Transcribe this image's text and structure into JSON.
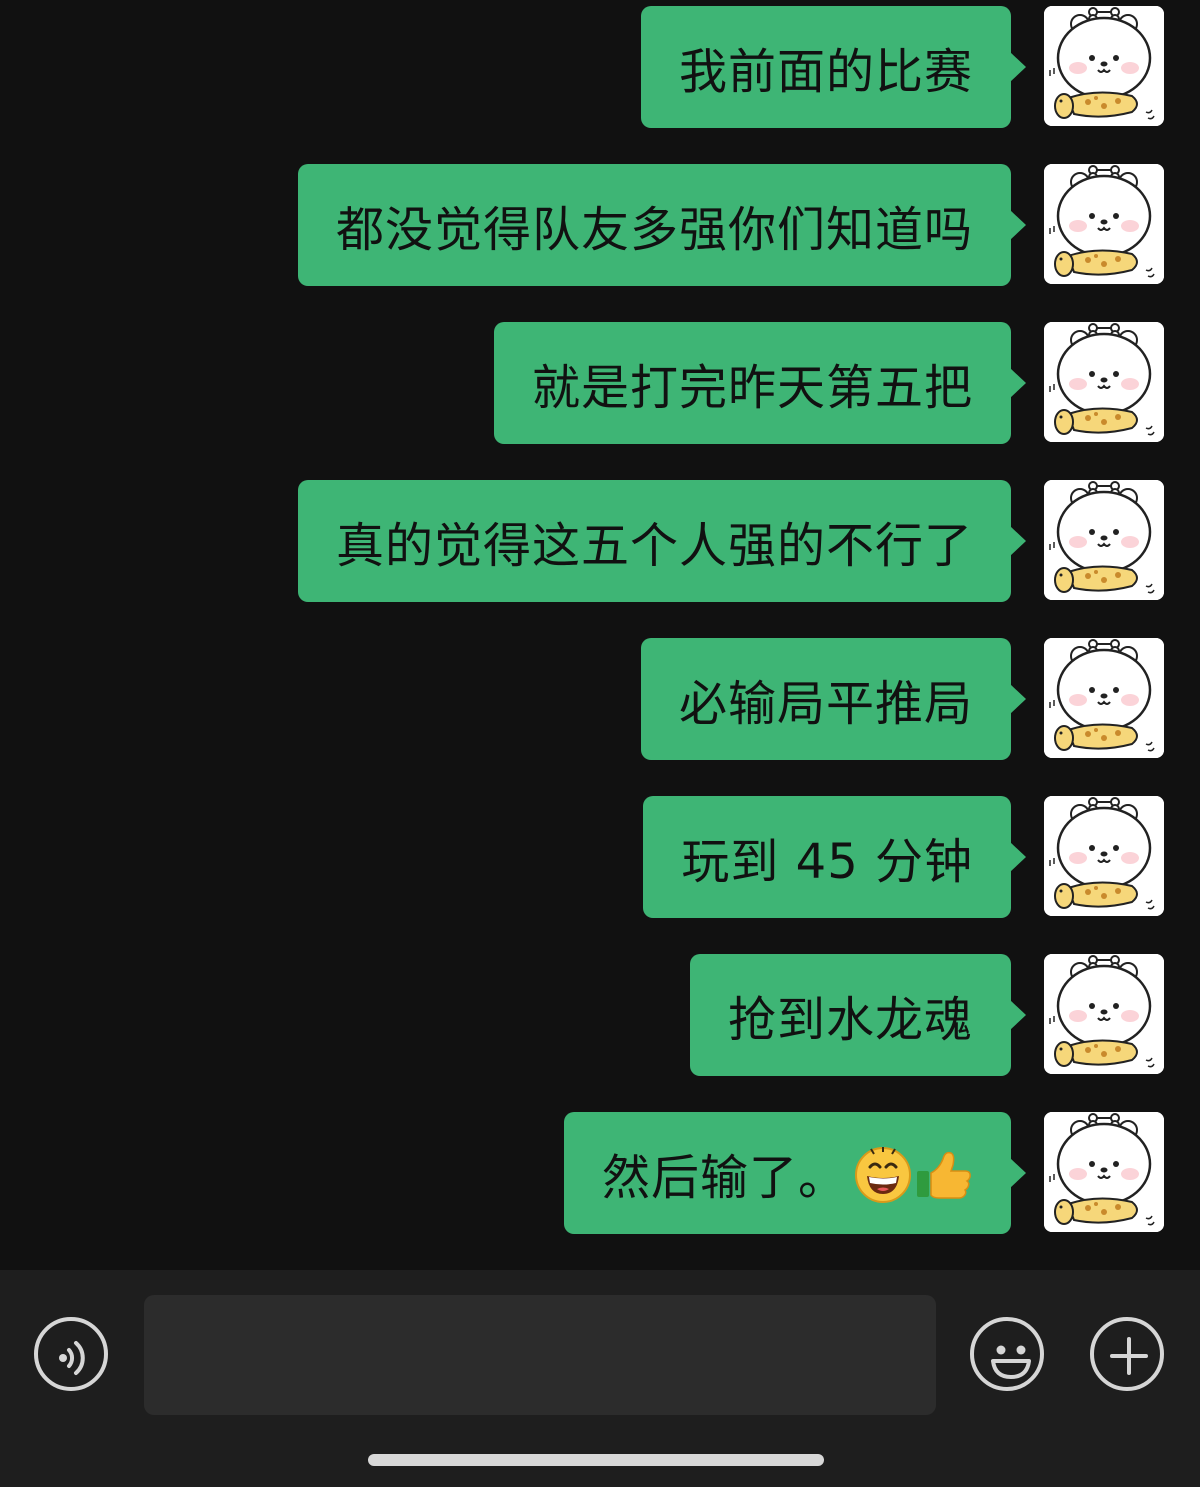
{
  "messages": [
    {
      "text": "我前面的比赛"
    },
    {
      "text": "都没觉得队友多强你们知道吗"
    },
    {
      "text": "就是打完昨天第五把"
    },
    {
      "text": "真的觉得这五个人强的不行了"
    },
    {
      "text": "必输局平推局"
    },
    {
      "text": "玩到 45 分钟"
    },
    {
      "text": "抢到水龙魂"
    },
    {
      "text": "然后输了。",
      "emojis": [
        "grinning-face-emoji",
        "thumbs-up-emoji"
      ]
    }
  ],
  "input": {
    "placeholder": ""
  },
  "icons": {
    "voice": "voice-icon",
    "emoji": "emoji-face-icon",
    "more": "plus-icon",
    "avatar": "bear-sticker-avatar"
  },
  "colors": {
    "background": "#111111",
    "bubble_outgoing": "#3eb575",
    "input_bar": "#1e1e1e"
  }
}
